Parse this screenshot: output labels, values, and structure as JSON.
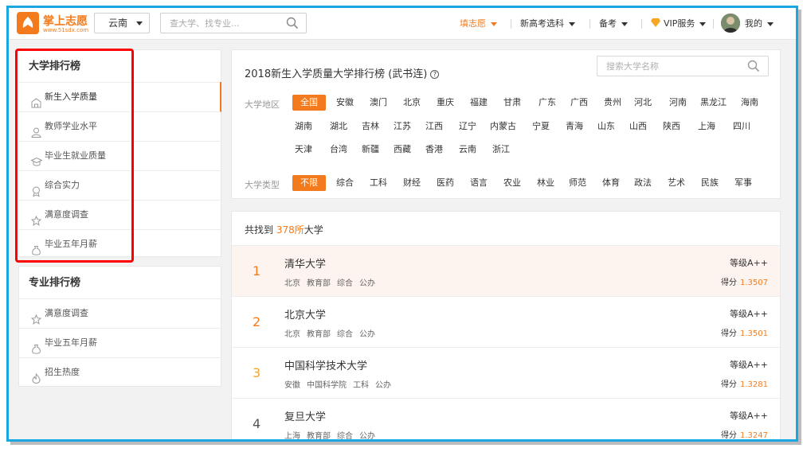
{
  "header": {
    "logo_name": "掌上志愿",
    "logo_url": "www.51sdx.com",
    "region": "云南",
    "search_placeholder": "查大学、找专业...",
    "nav": [
      {
        "label": "填志愿",
        "active": true
      },
      {
        "label": "新高考选科"
      },
      {
        "label": "备考"
      },
      {
        "label": "VIP服务"
      },
      {
        "label": "我的"
      }
    ]
  },
  "sidebar": {
    "university_rank": {
      "title": "大学排行榜",
      "items": [
        {
          "label": "新生入学质量",
          "icon": "building-icon",
          "active": true
        },
        {
          "label": "教师学业水平",
          "icon": "teacher-icon"
        },
        {
          "label": "毕业生就业质量",
          "icon": "graduation-cap-icon"
        },
        {
          "label": "综合实力",
          "icon": "medal-icon"
        },
        {
          "label": "满意度调查",
          "icon": "star-icon"
        },
        {
          "label": "毕业五年月薪",
          "icon": "money-bag-icon"
        }
      ]
    },
    "major_rank": {
      "title": "专业排行榜",
      "items": [
        {
          "label": "满意度调查",
          "icon": "star-icon"
        },
        {
          "label": "毕业五年月薪",
          "icon": "money-bag-icon"
        },
        {
          "label": "招生热度",
          "icon": "flame-icon"
        }
      ]
    }
  },
  "filters": {
    "title": "2018新生入学质量大学排行榜 (武书连)",
    "search_placeholder": "搜索大学名称",
    "region_label": "大学地区",
    "regions": [
      "全国",
      "安徽",
      "澳门",
      "北京",
      "重庆",
      "福建",
      "甘肃",
      "广东",
      "广西",
      "贵州",
      "河北",
      "河南",
      "黑龙江",
      "海南",
      "湖南",
      "湖北",
      "吉林",
      "江苏",
      "江西",
      "辽宁",
      "内蒙古",
      "宁夏",
      "青海",
      "山东",
      "山西",
      "陕西",
      "上海",
      "四川",
      "天津",
      "台湾",
      "新疆",
      "西藏",
      "香港",
      "云南",
      "浙江"
    ],
    "type_label": "大学类型",
    "types": [
      "不限",
      "综合",
      "工科",
      "财经",
      "医药",
      "语言",
      "农业",
      "林业",
      "师范",
      "体育",
      "政法",
      "艺术",
      "民族",
      "军事"
    ]
  },
  "results": {
    "count_prefix": "共找到",
    "count": "378所",
    "count_suffix": "大学",
    "grade_prefix": "等级",
    "score_prefix": "得分",
    "rows": [
      {
        "rank": "1",
        "name": "清华大学",
        "tags": [
          "北京",
          "教育部",
          "综合",
          "公办"
        ],
        "grade": "A++",
        "score": "1.3507"
      },
      {
        "rank": "2",
        "name": "北京大学",
        "tags": [
          "北京",
          "教育部",
          "综合",
          "公办"
        ],
        "grade": "A++",
        "score": "1.3501"
      },
      {
        "rank": "3",
        "name": "中国科学技术大学",
        "tags": [
          "安徽",
          "中国科学院",
          "工科",
          "公办"
        ],
        "grade": "A++",
        "score": "1.3281"
      },
      {
        "rank": "4",
        "name": "复旦大学",
        "tags": [
          "上海",
          "教育部",
          "综合",
          "公办"
        ],
        "grade": "A++",
        "score": "1.3247"
      }
    ]
  },
  "colors": {
    "accent": "#f37b1d",
    "frame": "#1aa6e0",
    "highlight": "#ff0000"
  }
}
